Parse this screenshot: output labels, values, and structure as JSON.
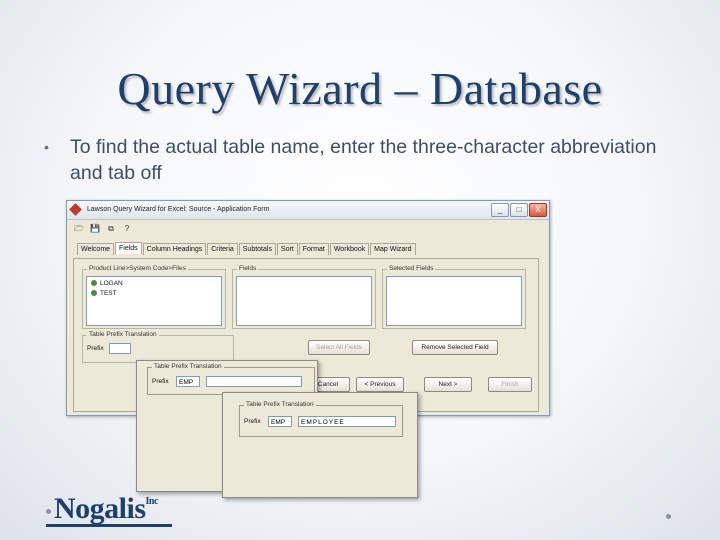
{
  "slide": {
    "title": "Query Wizard – Database",
    "bullet": "To find the actual table name, enter the three-character abbreviation and tab off",
    "bullet_mark": "•",
    "logo_name": "Nogalis",
    "logo_suffix": "Inc"
  },
  "window": {
    "title": "Lawson Query Wizard for Excel: Source - Application Form",
    "buttons": {
      "minimize": "_",
      "maximize": "□",
      "close": "X"
    },
    "toolbar": [
      "open-icon",
      "save-icon",
      "copy-icon",
      "help-icon"
    ],
    "toolbar_glyphs": [
      "🗁",
      "💾",
      "⧉",
      "?"
    ],
    "tabs": [
      "Welcome",
      "Fields",
      "Column Headings",
      "Criteria",
      "Subtotals",
      "Sort",
      "Format",
      "Workbook",
      "Map Wizard"
    ],
    "active_tab": "Fields",
    "groups": {
      "product_line": "Product Line>System Code>Files",
      "fields": "Fields",
      "selected_fields": "Selected Fields"
    },
    "product_items": [
      "LOGAN",
      "TEST"
    ],
    "select_all_label": "Select All Fields",
    "remove_selected_label": "Remove Selected Field",
    "prefix_group_label": "Table Prefix Translation",
    "prefix_label": "Prefix",
    "prefix_value": "",
    "nav_buttons": {
      "cancel": "Cancel",
      "previous": "< Previous",
      "next": "Next >",
      "finish": "Finish"
    }
  },
  "popup1": {
    "group_label": "Table Prefix Translation",
    "prefix_label": "Prefix",
    "prefix_value": "EMP",
    "result_value": ""
  },
  "popup2": {
    "group_label": "Table Prefix Translation",
    "prefix_label": "Prefix",
    "prefix_value": "EMP",
    "result_value": "EMPLOYEE"
  },
  "colors": {
    "title": "#1f3f6d",
    "bullet": "#3c4f6a",
    "window_bg": "#ece9d8"
  }
}
